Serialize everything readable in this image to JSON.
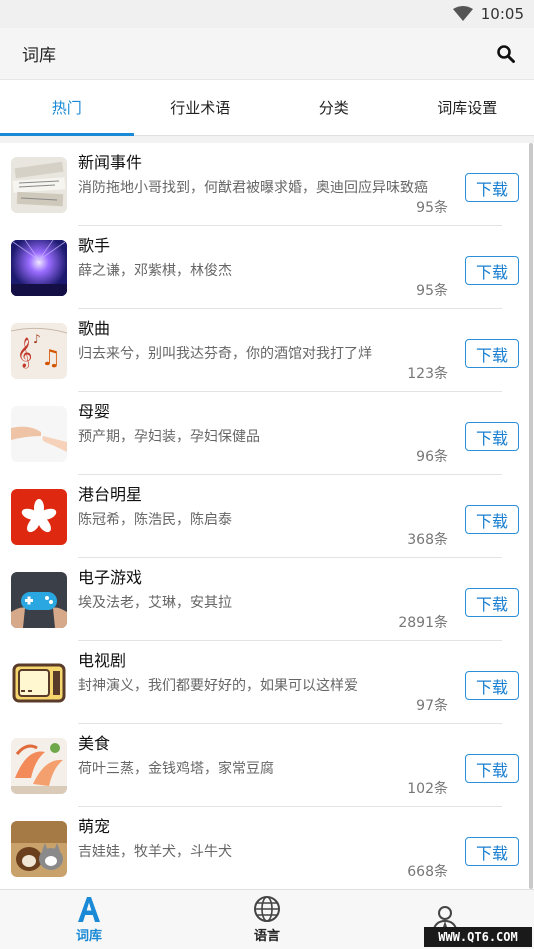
{
  "status_bar": {
    "time": "10:05"
  },
  "app_bar": {
    "title": "词库"
  },
  "tabs": [
    {
      "label": "热门",
      "active": true
    },
    {
      "label": "行业术语",
      "active": false
    },
    {
      "label": "分类",
      "active": false
    },
    {
      "label": "词库设置",
      "active": false
    }
  ],
  "list": {
    "download_label": "下载",
    "items": [
      {
        "title": "新闻事件",
        "desc": "消防拖地小哥找到，何猷君被曝求婚，奥迪回应异味致癌",
        "count": "95条",
        "icon": "newspaper-thumb"
      },
      {
        "title": "歌手",
        "desc": "薛之谦，邓紫棋，林俊杰",
        "count": "95条",
        "icon": "concert-thumb"
      },
      {
        "title": "歌曲",
        "desc": "归去来兮，别叫我达芬奇，你的酒馆对我打了烊",
        "count": "123条",
        "icon": "music-notes-thumb"
      },
      {
        "title": "母婴",
        "desc": "预产期，孕妇装，孕妇保健品",
        "count": "96条",
        "icon": "hands-thumb"
      },
      {
        "title": "港台明星",
        "desc": "陈冠希，陈浩民，陈启泰",
        "count": "368条",
        "icon": "hong-kong-flag-thumb"
      },
      {
        "title": "电子游戏",
        "desc": "埃及法老，艾琳，安其拉",
        "count": "2891条",
        "icon": "gamepad-thumb"
      },
      {
        "title": "电视剧",
        "desc": "封神演义，我们都要好好的，如果可以这样爱",
        "count": "97条",
        "icon": "tv-thumb"
      },
      {
        "title": "美食",
        "desc": "荷叶三蒸，金钱鸡塔，家常豆腐",
        "count": "102条",
        "icon": "seafood-thumb"
      },
      {
        "title": "萌宠",
        "desc": "吉娃娃，牧羊犬，斗牛犬",
        "count": "668条",
        "icon": "pets-thumb"
      }
    ]
  },
  "bottom_nav": [
    {
      "label": "词库",
      "icon": "letter-a-icon",
      "active": true
    },
    {
      "label": "语言",
      "icon": "globe-icon",
      "active": false
    },
    {
      "label": "",
      "icon": "person-icon",
      "active": false
    }
  ],
  "watermark": "WWW.QT6.COM",
  "colors": {
    "accent": "#1a8ad6",
    "button_border": "#2a8fd8"
  }
}
